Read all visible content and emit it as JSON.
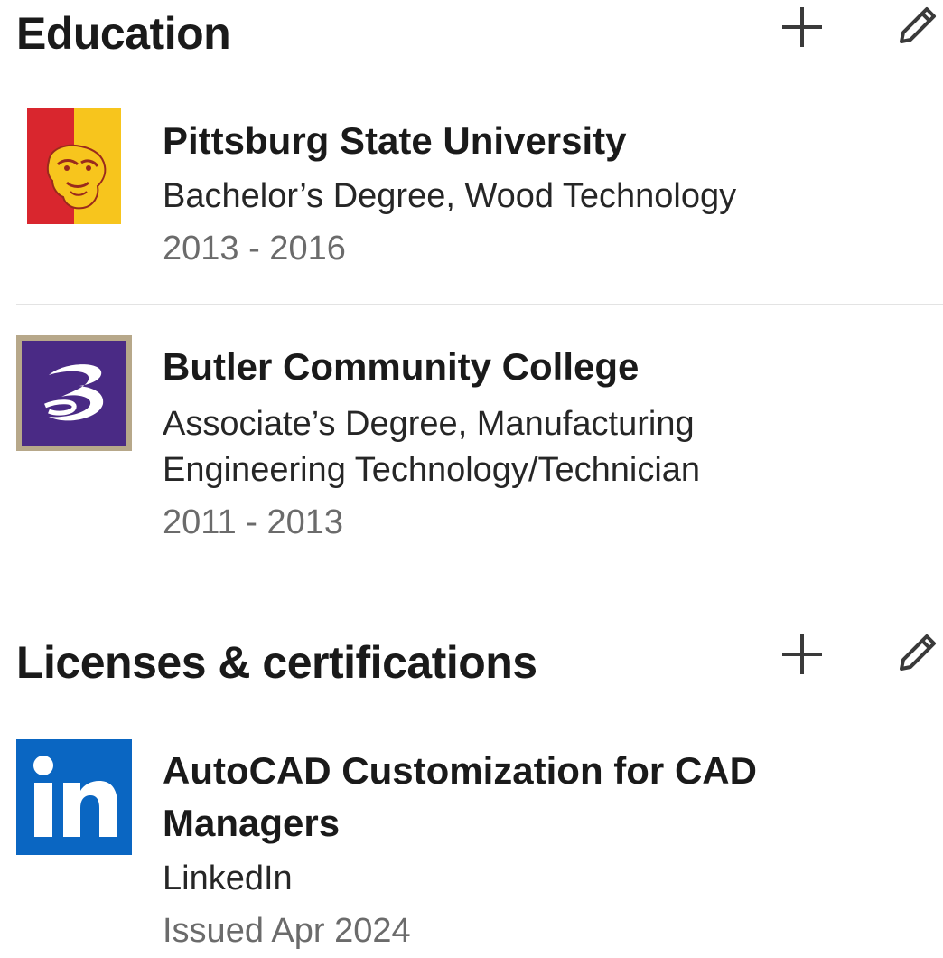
{
  "education": {
    "title": "Education",
    "add_icon": "plus-icon",
    "edit_icon": "pencil-icon",
    "items": [
      {
        "school": "Pittsburg State University",
        "degree": "Bachelor’s Degree, Wood Technology",
        "years": "2013 - 2016",
        "logo": "gorilla-logo",
        "logo_colors": {
          "left": "#d9262e",
          "right": "#f7c51d"
        }
      },
      {
        "school": "Butler Community College",
        "degree_line1": "Associate’s Degree, Manufacturing",
        "degree_line2": "Engineering Technology/Technician",
        "years": "2011 - 2013",
        "logo": "butler-swoosh-logo",
        "logo_colors": {
          "fill": "#4a2a85",
          "border": "#b7a88a"
        }
      }
    ]
  },
  "licenses": {
    "title": "Licenses & certifications",
    "add_icon": "plus-icon",
    "edit_icon": "pencil-icon",
    "items": [
      {
        "name_line1": "AutoCAD Customization for CAD",
        "name_line2": "Managers",
        "issuer": "LinkedIn",
        "issued": "Issued Apr 2024",
        "logo": "linkedin-logo",
        "logo_colors": {
          "fill": "#0a66c2"
        }
      }
    ]
  }
}
